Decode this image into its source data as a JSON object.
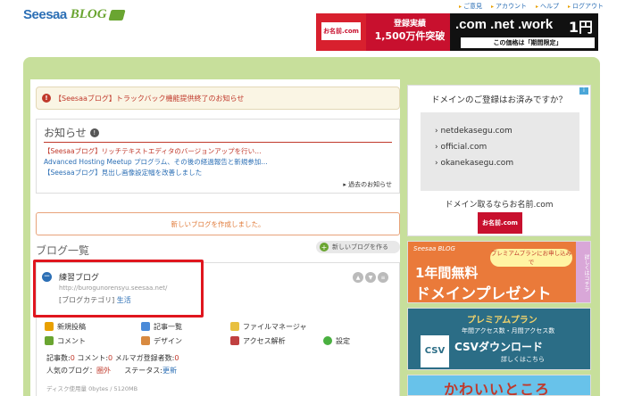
{
  "header": {
    "logo_main": "Seesaa",
    "logo_sub": "BLOG",
    "nav": [
      "ご意見",
      "アカウント",
      "ヘルプ",
      "ログアウト"
    ]
  },
  "top_banner": {
    "mini_logo": "お名前.com",
    "line1": "登録実績",
    "line2": "1,500万件突破",
    "domains": ".com .net .work",
    "price": "1円",
    "caption": "この価格は「期間限定」"
  },
  "notice": {
    "text": "【Seesaaブログ】トラックバック機能提供終了のお知らせ"
  },
  "news": {
    "title": "お知らせ",
    "items": [
      "【Seesaaブログ】リッチテキストエディタのバージョンアップを行い…",
      "Advanced Hosting Meetup プログラム、その後の経過報告と新規参加…",
      "【Seesaaブログ】見出し画像設定幅を改善しました"
    ],
    "past_link": "過去のお知らせ"
  },
  "create_blog": {
    "label": "新しいブログを作成しました。"
  },
  "blog_list": {
    "title": "ブログ一覧",
    "new_button": "新しいブログを作る"
  },
  "blog": {
    "name": "練習ブログ",
    "url": "http://burogunorensyu.seesaa.net/",
    "category_label": "[ブログカテゴリ]",
    "category_value": "生活",
    "menu": [
      [
        {
          "label": "新規投稿",
          "icon": "pencil-icon",
          "color": "#e8a000"
        },
        {
          "label": "記事一覧",
          "icon": "list-icon",
          "color": "#4a8ad8"
        },
        {
          "label": "ファイルマネージャ",
          "icon": "folder-icon",
          "color": "#e8c040"
        }
      ],
      [
        {
          "label": "コメント",
          "icon": "comment-icon",
          "color": "#6aa531"
        },
        {
          "label": "デザイン",
          "icon": "palette-icon",
          "color": "#d88a40"
        },
        {
          "label": "アクセス解析",
          "icon": "chart-icon",
          "color": "#c04040"
        },
        {
          "label": "設定",
          "icon": "gear-icon",
          "color": "#4ab040"
        }
      ]
    ],
    "stats": {
      "articles_label": "記事数:",
      "articles": "0",
      "comments_label": "コメント:",
      "comments": "0",
      "mailmag_label": "メルマガ登録者数:",
      "mailmag": "0",
      "popularity_label": "人気のブログ：",
      "popularity": "圏外",
      "status_label": "ステータス:",
      "status": "更新"
    },
    "disk": "ディスク使用量 0bytes / 5120MB"
  },
  "ads": {
    "domain_ad": {
      "title": "ドメインのご登録はお済みですか？",
      "domains": [
        "netdekasegu.com",
        "official.com",
        "okanekasegu.com"
      ],
      "subtitle": "ドメイン取るならお名前.com",
      "logo": "お名前.com"
    },
    "premium_ad": {
      "brand": "Seesaa BLOG",
      "bubble": "プレミアムプランにお申し込みで",
      "line1": "1年間無料",
      "line2": "ドメインプレゼント",
      "side": "詳しくはコチラ"
    },
    "csv_ad": {
      "title": "プレミアムプラン",
      "sub": "年間アクセス数・月間アクセス数",
      "main": "CSVダウンロード",
      "link": "詳しくはこちら",
      "badge": "CSV"
    },
    "bottom_ad": {
      "text": "かわいいところ"
    }
  }
}
